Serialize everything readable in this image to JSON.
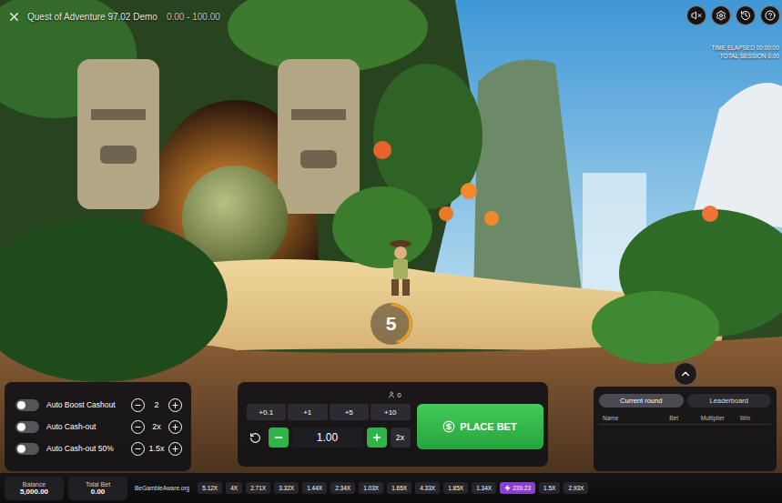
{
  "window": {
    "title": "Quest of Adventure 97.02 Demo",
    "range": "0.00 - 100.00"
  },
  "sound": {
    "muted": true
  },
  "session": {
    "lines": [
      "TIME ELAPSED 00:00:00",
      "TOTAL SESSION 0.00"
    ]
  },
  "countdown": {
    "value": "5",
    "level": 0.45
  },
  "auto_settings": [
    {
      "label": "Auto Boost Cashout",
      "on": false,
      "value": "2"
    },
    {
      "label": "Auto Cash-out",
      "on": false,
      "value": "2x"
    },
    {
      "label": "Auto Cash-out 50%",
      "on": false,
      "value": "1.5x"
    }
  ],
  "bet": {
    "players": "0",
    "quick": [
      "+0.1",
      "+1",
      "+5",
      "+10"
    ],
    "amount": "1.00",
    "double": "2x",
    "place": "PLACE BET"
  },
  "leaderboard": {
    "tabs": [
      {
        "label": "Current round",
        "selected": true
      },
      {
        "label": "Leaderboard",
        "selected": false
      }
    ],
    "columns": [
      "Name",
      "Bet",
      "Multiplier",
      "Win"
    ],
    "rows": []
  },
  "status_bar": {
    "balance": {
      "label": "Balance",
      "value": "5,000.00"
    },
    "total_bet": {
      "label": "Total Bet",
      "value": "0.00"
    },
    "responsible": "BeGambleAware.org"
  },
  "history": [
    {
      "value": "5.12X",
      "highlighted": false
    },
    {
      "value": "4X",
      "highlighted": false
    },
    {
      "value": "2.71X",
      "highlighted": false
    },
    {
      "value": "3.32X",
      "highlighted": false
    },
    {
      "value": "1.44X",
      "highlighted": false
    },
    {
      "value": "2.34X",
      "highlighted": false
    },
    {
      "value": "1.03X",
      "highlighted": false
    },
    {
      "value": "1.65X",
      "highlighted": false
    },
    {
      "value": "4.33X",
      "highlighted": false
    },
    {
      "value": "1.85X",
      "highlighted": false
    },
    {
      "value": "1.34X",
      "highlighted": false
    },
    {
      "value": "239.23",
      "highlighted": true
    },
    {
      "value": "1.5X",
      "highlighted": false
    },
    {
      "value": "2.93X",
      "highlighted": false
    }
  ]
}
